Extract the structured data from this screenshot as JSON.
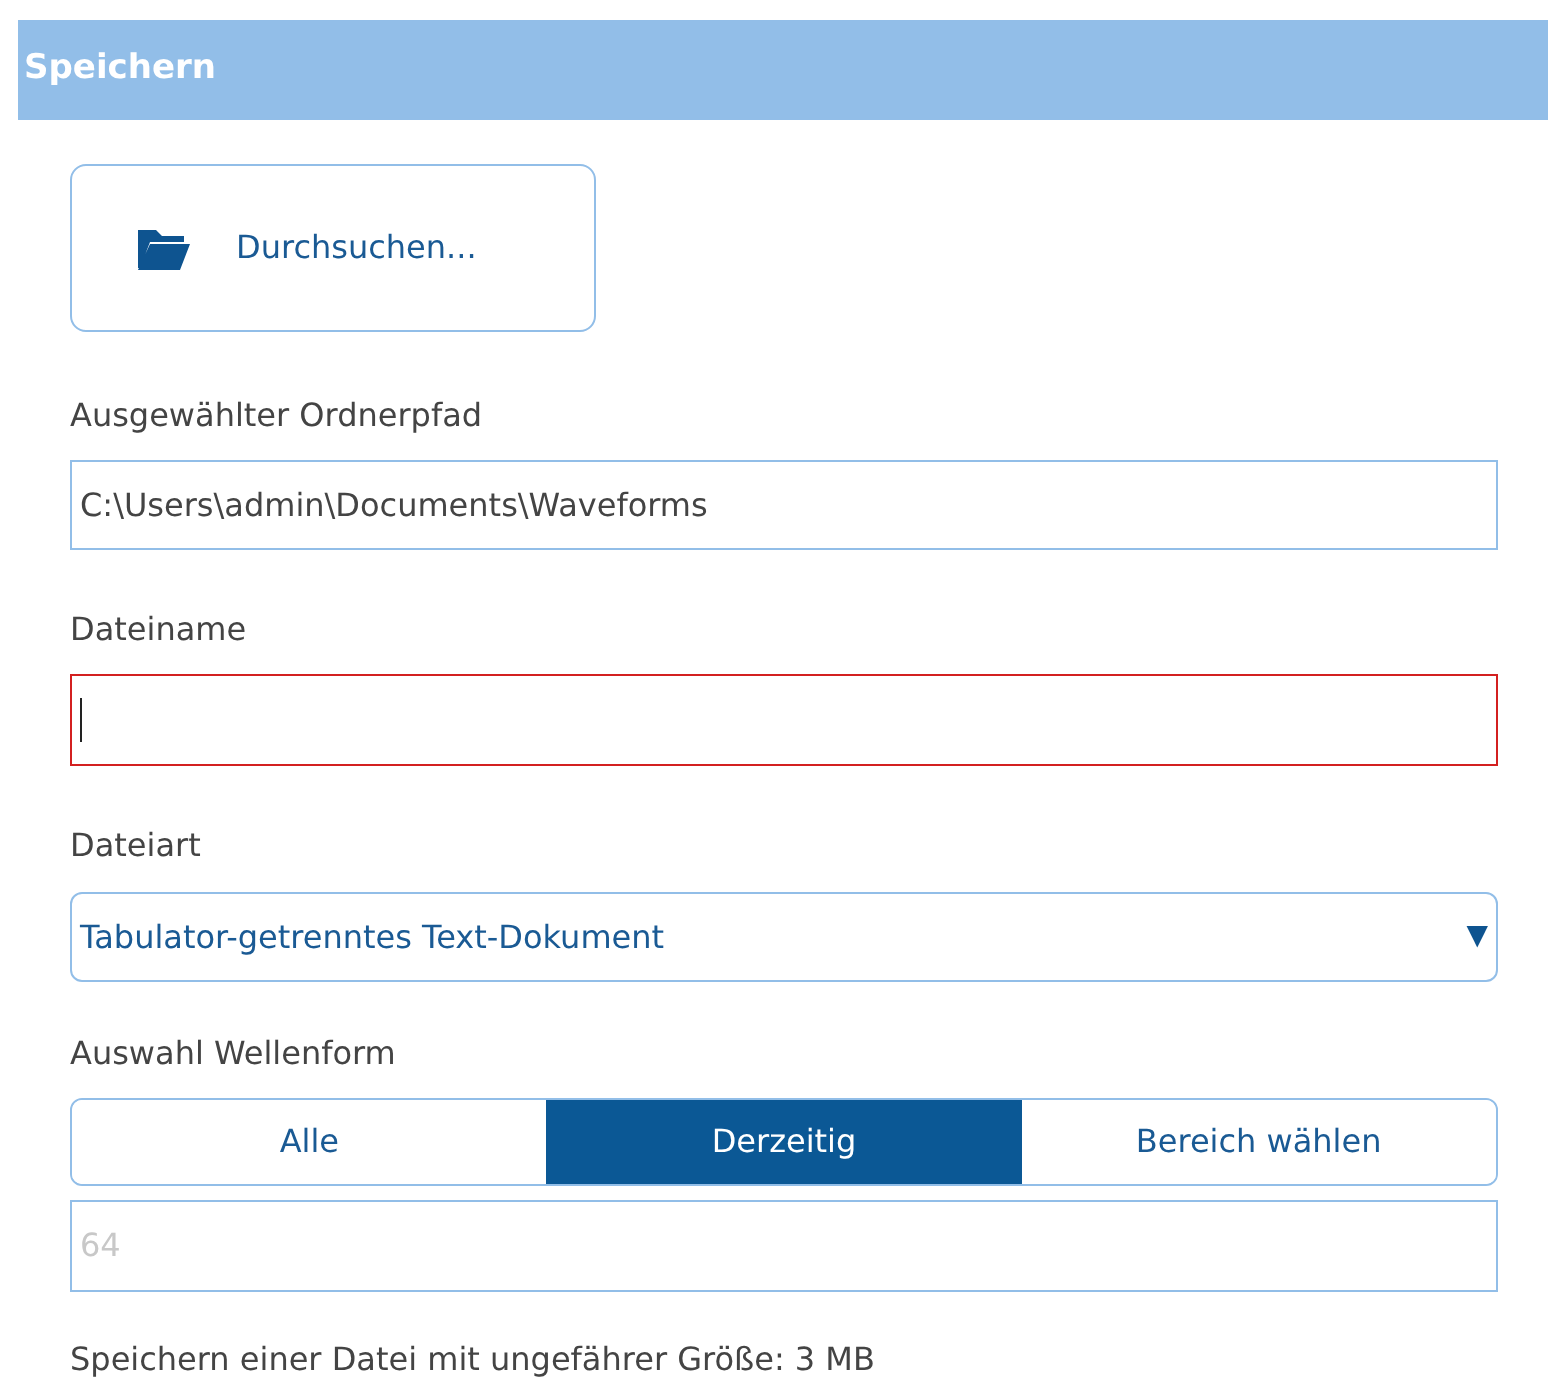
{
  "panel": {
    "title": "Speichern"
  },
  "browse_button": {
    "label": "Durchsuchen..."
  },
  "folder_path": {
    "label": "Ausgewählter Ordnerpfad",
    "value": "C:\\Users\\admin\\Documents\\Waveforms"
  },
  "file_name": {
    "label": "Dateiname",
    "invalid": true
  },
  "file_type": {
    "label": "Dateiart",
    "value": "Tabulator-getrenntes Text-Dokument",
    "arrow": "▼"
  },
  "waveform_selection": {
    "label": "Auswahl Wellenform",
    "options": [
      {
        "label": "Alle",
        "selected": false
      },
      {
        "label": "Derzeitig",
        "selected": true
      },
      {
        "label": "Bereich wählen",
        "selected": false
      }
    ],
    "count": {
      "value": "64",
      "disabled": true
    }
  },
  "size_note": "Speichern einer Datei mit ungefährer Größe: 3 MB"
}
